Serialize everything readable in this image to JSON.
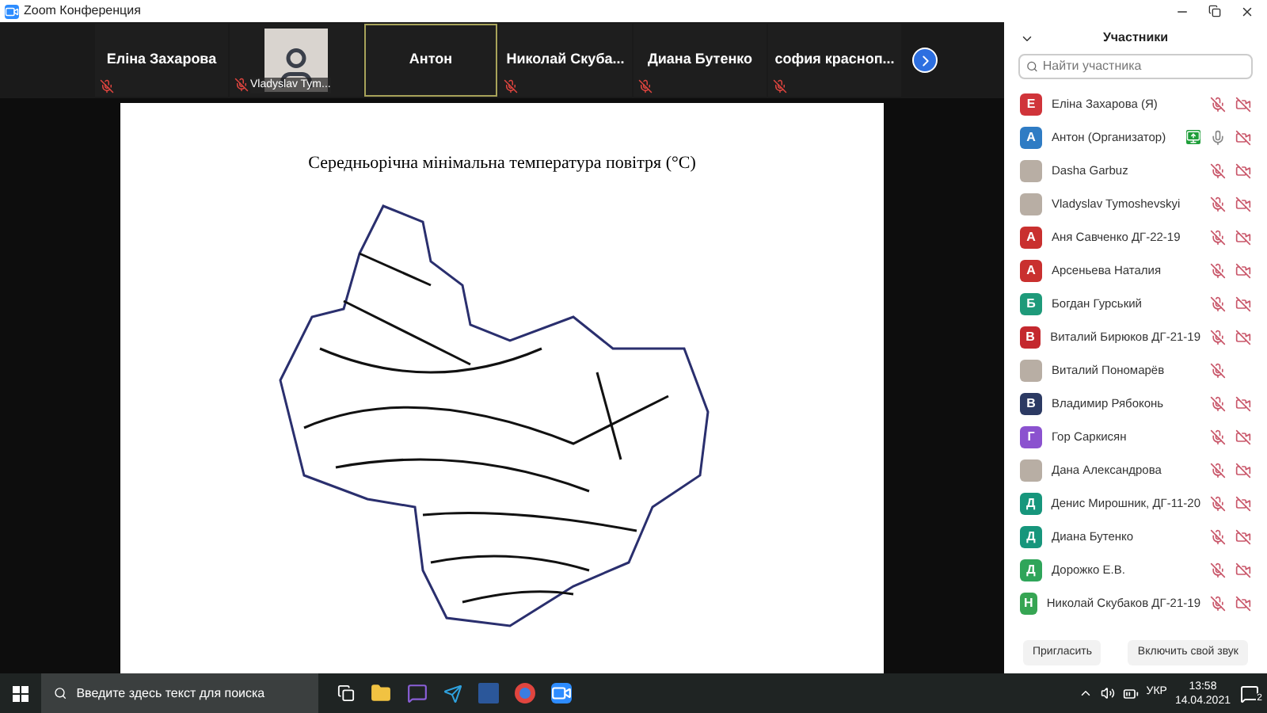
{
  "window": {
    "title": "Zoom Конференция"
  },
  "gallery": {
    "tiles": [
      {
        "name": "Еліна Захарова",
        "kind": "name",
        "muted": true,
        "active": false
      },
      {
        "name": "Vladyslav Tym...",
        "kind": "photo",
        "muted": true,
        "active": false
      },
      {
        "name": "Антон",
        "kind": "name",
        "muted": false,
        "active": true
      },
      {
        "name": "Николай Скуба...",
        "kind": "name",
        "muted": true,
        "active": false
      },
      {
        "name": "Диана Бутенко",
        "kind": "name",
        "muted": true,
        "active": false
      },
      {
        "name": "софия краснoп...",
        "kind": "name",
        "muted": true,
        "active": false
      }
    ]
  },
  "shared_screen": {
    "title": "Середньорічна мінімальна температура повітря (°С)"
  },
  "participants_panel": {
    "title": "Участники",
    "search": {
      "placeholder": "Найти участника"
    },
    "participants": [
      {
        "name": "Еліна Захарова (Я)",
        "kind": "initial",
        "initial": "Е",
        "color": "#d0343a",
        "sharing": false,
        "mic_muted": true,
        "video_off_icon": true
      },
      {
        "name": "Антон (Организатор)",
        "kind": "initial",
        "initial": "А",
        "color": "#2f7cc4",
        "sharing": true,
        "mic_muted": false,
        "video_off_icon": true
      },
      {
        "name": "Dasha Garbuz",
        "kind": "photo",
        "sharing": false,
        "mic_muted": true,
        "video_off_icon": true
      },
      {
        "name": "Vladyslav Tymoshevskyi",
        "kind": "photo",
        "sharing": false,
        "mic_muted": true,
        "video_off_icon": true
      },
      {
        "name": "Аня Савченко ДГ-22-19",
        "kind": "initial",
        "initial": "А",
        "color": "#c9302f",
        "sharing": false,
        "mic_muted": true,
        "video_off_icon": true
      },
      {
        "name": "Арсеньева Наталия",
        "kind": "initial",
        "initial": "А",
        "color": "#c9302f",
        "sharing": false,
        "mic_muted": true,
        "video_off_icon": true
      },
      {
        "name": "Богдан Гурський",
        "kind": "initial",
        "initial": "Б",
        "color": "#1e9a7a",
        "sharing": false,
        "mic_muted": true,
        "video_off_icon": true
      },
      {
        "name": "Виталий Бирюков ДГ-21-19",
        "kind": "initial",
        "initial": "В",
        "color": "#c4282e",
        "sharing": false,
        "mic_muted": true,
        "video_off_icon": true
      },
      {
        "name": "Виталий Пономарёв",
        "kind": "photo",
        "sharing": false,
        "mic_muted": true,
        "video_off_icon": false
      },
      {
        "name": "Владимир Рябоконь",
        "kind": "initial",
        "initial": "В",
        "color": "#2c3a63",
        "sharing": false,
        "mic_muted": true,
        "video_off_icon": true
      },
      {
        "name": "Гор Саркисян",
        "kind": "initial",
        "initial": "Г",
        "color": "#8b52cf",
        "sharing": false,
        "mic_muted": true,
        "video_off_icon": true
      },
      {
        "name": "Дана Александрова",
        "kind": "photo",
        "sharing": false,
        "mic_muted": true,
        "video_off_icon": true
      },
      {
        "name": "Денис Мирошник, ДГ-11-20",
        "kind": "initial",
        "initial": "Д",
        "color": "#17967c",
        "sharing": false,
        "mic_muted": true,
        "video_off_icon": true
      },
      {
        "name": "Диана Бутенко",
        "kind": "initial",
        "initial": "Д",
        "color": "#17967c",
        "sharing": false,
        "mic_muted": true,
        "video_off_icon": true
      },
      {
        "name": "Дорожко Е.В.",
        "kind": "initial",
        "initial": "Д",
        "color": "#2fa55a",
        "sharing": false,
        "mic_muted": true,
        "video_off_icon": true
      },
      {
        "name": "Николай Скубаков ДГ-21-19",
        "kind": "initial",
        "initial": "Н",
        "color": "#36a553",
        "sharing": false,
        "mic_muted": true,
        "video_off_icon": true
      }
    ],
    "buttons": [
      "Пригласить",
      "Включить свой звук"
    ]
  },
  "taskbar": {
    "search": {
      "placeholder": "Введите здесь текст для поиска"
    },
    "language": "УКР",
    "time": "13:58",
    "date": "14.04.2021",
    "notifications": "2"
  }
}
